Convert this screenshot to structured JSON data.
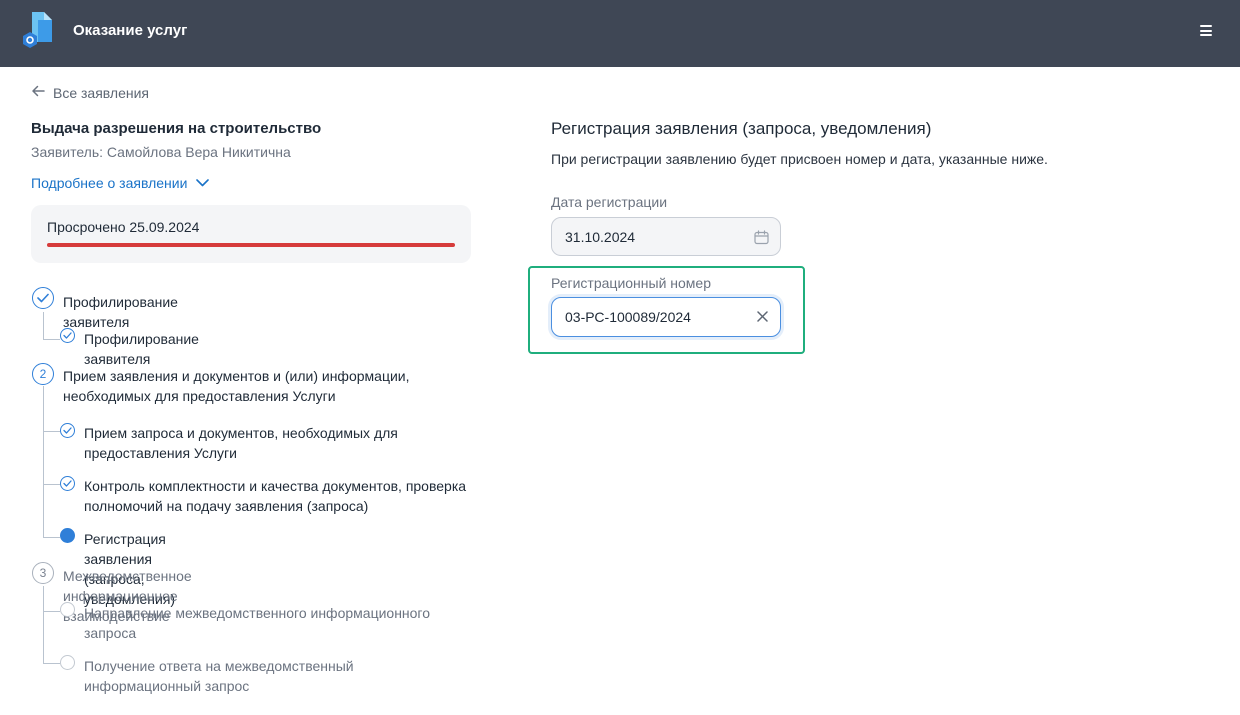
{
  "header": {
    "app_title": "Оказание услуг",
    "logo_icon": "app-logo-icon",
    "menu_icon": "hamburger-menu-icon",
    "background": "#3f4755"
  },
  "nav": {
    "back_label": "Все заявления"
  },
  "request": {
    "title": "Выдача разрешения на строительство",
    "applicant": "Заявитель: Самойлова Вера Никитична",
    "details_link": "Подробнее о заявлении",
    "overdue_text": "Просрочено 25.09.2024",
    "overdue_color": "#d63b3b"
  },
  "steps": [
    {
      "number": "",
      "label": "Профилирование заявителя",
      "state": "done",
      "substeps": [
        {
          "label": "Профилирование заявителя",
          "state": "done"
        }
      ]
    },
    {
      "number": "2",
      "label": "Прием заявления и документов и (или) информации, необходимых для предоставления Услуги",
      "state": "current",
      "substeps": [
        {
          "label": "Прием запроса и документов, необходимых для предоставления Услуги",
          "state": "done"
        },
        {
          "label": "Контроль комплектности и качества документов, проверка полномочий на подачу заявления (запроса)",
          "state": "done"
        },
        {
          "label": "Регистрация заявления (запроса, уведомления)",
          "state": "current"
        }
      ]
    },
    {
      "number": "3",
      "label": "Межведомственное информационное взаимодействие",
      "state": "pending",
      "substeps": [
        {
          "label": "Направление межведомственного информационного запроса",
          "state": "pending"
        },
        {
          "label": "Получение ответа на межведомственный информационный запрос",
          "state": "pending"
        }
      ]
    }
  ],
  "form": {
    "title": "Регистрация заявления (запроса, уведомления)",
    "note": "При регистрации заявлению будет присвоен номер и дата, указанные ниже.",
    "date_label": "Дата регистрации",
    "date_value": "31.10.2024",
    "number_label": "Регистрационный номер",
    "number_value": "03-РС-100089/2024",
    "accent": "#2f7fd8",
    "highlight_color": "#1fae7d"
  }
}
